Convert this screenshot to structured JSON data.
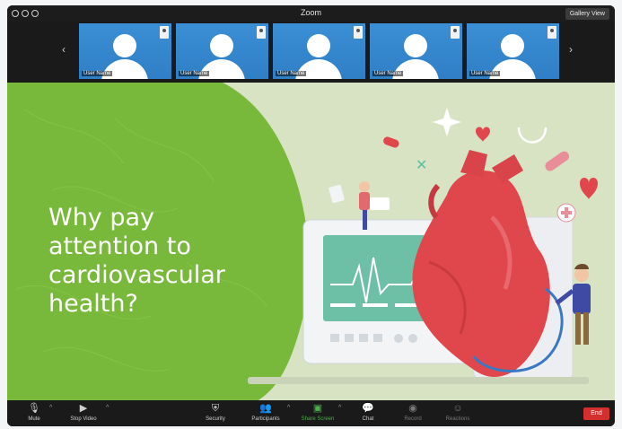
{
  "window": {
    "title": "Zoom",
    "gallery_view_label": "Gallery View"
  },
  "thumbnails": [
    {
      "name": "User Name"
    },
    {
      "name": "User Name"
    },
    {
      "name": "User Name"
    },
    {
      "name": "User Name"
    },
    {
      "name": "User Name"
    }
  ],
  "slide": {
    "title": "Why pay\nattention to\ncardiovascular\nhealth?"
  },
  "toolbar": {
    "mute": "Mute",
    "stop_video": "Stop Video",
    "security": "Security",
    "participants": "Participants",
    "share_screen": "Share Screen",
    "chat": "Chat",
    "record": "Record",
    "reactions": "Reactions",
    "end": "End"
  },
  "colors": {
    "accent_green": "#4cae4c",
    "end_red": "#d32f2f",
    "thumb_blue": "#3b8fd4",
    "slide_green": "#78b83a"
  }
}
